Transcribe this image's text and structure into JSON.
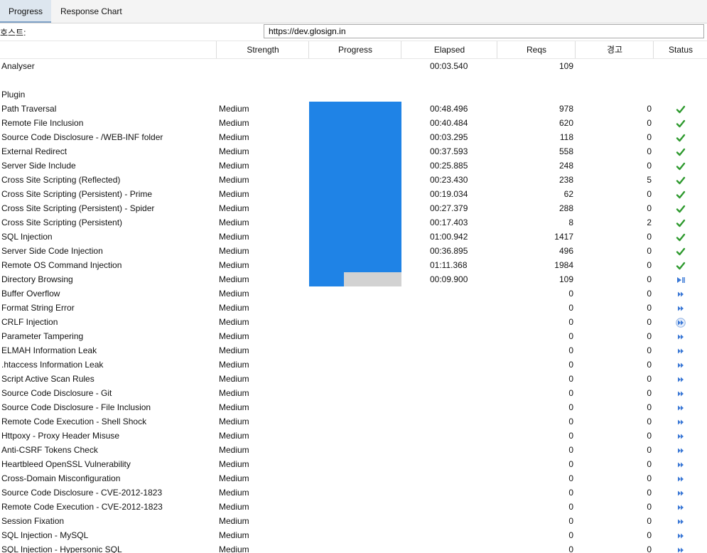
{
  "tabs": [
    {
      "label": "Progress",
      "active": true
    },
    {
      "label": "Response Chart",
      "active": false
    }
  ],
  "host": {
    "label": "호스트:",
    "value": "https://dev.glosign.in"
  },
  "columns": [
    "",
    "Strength",
    "Progress",
    "Elapsed",
    "Reqs",
    "경고",
    "Status"
  ],
  "analyser": {
    "name": "Analyser",
    "elapsed": "00:03.540",
    "reqs": "109"
  },
  "plugin_header": "Plugin",
  "plugins": [
    {
      "name": "Path Traversal",
      "strength": "Medium",
      "progress": 100,
      "elapsed": "00:48.496",
      "reqs": "978",
      "alerts": "0",
      "status": "done"
    },
    {
      "name": "Remote File Inclusion",
      "strength": "Medium",
      "progress": 100,
      "elapsed": "00:40.484",
      "reqs": "620",
      "alerts": "0",
      "status": "done"
    },
    {
      "name": "Source Code Disclosure - /WEB-INF folder",
      "strength": "Medium",
      "progress": 100,
      "elapsed": "00:03.295",
      "reqs": "118",
      "alerts": "0",
      "status": "done"
    },
    {
      "name": "External Redirect",
      "strength": "Medium",
      "progress": 100,
      "elapsed": "00:37.593",
      "reqs": "558",
      "alerts": "0",
      "status": "done"
    },
    {
      "name": "Server Side Include",
      "strength": "Medium",
      "progress": 100,
      "elapsed": "00:25.885",
      "reqs": "248",
      "alerts": "0",
      "status": "done"
    },
    {
      "name": "Cross Site Scripting (Reflected)",
      "strength": "Medium",
      "progress": 100,
      "elapsed": "00:23.430",
      "reqs": "238",
      "alerts": "5",
      "status": "done"
    },
    {
      "name": "Cross Site Scripting (Persistent) - Prime",
      "strength": "Medium",
      "progress": 100,
      "elapsed": "00:19.034",
      "reqs": "62",
      "alerts": "0",
      "status": "done"
    },
    {
      "name": "Cross Site Scripting (Persistent) - Spider",
      "strength": "Medium",
      "progress": 100,
      "elapsed": "00:27.379",
      "reqs": "288",
      "alerts": "0",
      "status": "done"
    },
    {
      "name": "Cross Site Scripting (Persistent)",
      "strength": "Medium",
      "progress": 100,
      "elapsed": "00:17.403",
      "reqs": "8",
      "alerts": "2",
      "status": "done"
    },
    {
      "name": "SQL Injection",
      "strength": "Medium",
      "progress": 100,
      "elapsed": "01:00.942",
      "reqs": "1417",
      "alerts": "0",
      "status": "done"
    },
    {
      "name": "Server Side Code Injection",
      "strength": "Medium",
      "progress": 100,
      "elapsed": "00:36.895",
      "reqs": "496",
      "alerts": "0",
      "status": "done"
    },
    {
      "name": "Remote OS Command Injection",
      "strength": "Medium",
      "progress": 100,
      "elapsed": "01:11.368",
      "reqs": "1984",
      "alerts": "0",
      "status": "done"
    },
    {
      "name": "Directory Browsing",
      "strength": "Medium",
      "progress": 38,
      "elapsed": "00:09.900",
      "reqs": "109",
      "alerts": "0",
      "status": "running"
    },
    {
      "name": "Buffer Overflow",
      "strength": "Medium",
      "progress": null,
      "elapsed": "",
      "reqs": "0",
      "alerts": "0",
      "status": "pending"
    },
    {
      "name": "Format String Error",
      "strength": "Medium",
      "progress": null,
      "elapsed": "",
      "reqs": "0",
      "alerts": "0",
      "status": "pending"
    },
    {
      "name": "CRLF Injection",
      "strength": "Medium",
      "progress": null,
      "elapsed": "",
      "reqs": "0",
      "alerts": "0",
      "status": "pending-hover"
    },
    {
      "name": "Parameter Tampering",
      "strength": "Medium",
      "progress": null,
      "elapsed": "",
      "reqs": "0",
      "alerts": "0",
      "status": "pending"
    },
    {
      "name": "ELMAH Information Leak",
      "strength": "Medium",
      "progress": null,
      "elapsed": "",
      "reqs": "0",
      "alerts": "0",
      "status": "pending"
    },
    {
      "name": ".htaccess Information Leak",
      "strength": "Medium",
      "progress": null,
      "elapsed": "",
      "reqs": "0",
      "alerts": "0",
      "status": "pending"
    },
    {
      "name": "Script Active Scan Rules",
      "strength": "Medium",
      "progress": null,
      "elapsed": "",
      "reqs": "0",
      "alerts": "0",
      "status": "pending"
    },
    {
      "name": "Source Code Disclosure - Git",
      "strength": "Medium",
      "progress": null,
      "elapsed": "",
      "reqs": "0",
      "alerts": "0",
      "status": "pending"
    },
    {
      "name": "Source Code Disclosure - File Inclusion",
      "strength": "Medium",
      "progress": null,
      "elapsed": "",
      "reqs": "0",
      "alerts": "0",
      "status": "pending"
    },
    {
      "name": "Remote Code Execution - Shell Shock",
      "strength": "Medium",
      "progress": null,
      "elapsed": "",
      "reqs": "0",
      "alerts": "0",
      "status": "pending"
    },
    {
      "name": "Httpoxy - Proxy Header Misuse",
      "strength": "Medium",
      "progress": null,
      "elapsed": "",
      "reqs": "0",
      "alerts": "0",
      "status": "pending"
    },
    {
      "name": "Anti-CSRF Tokens Check",
      "strength": "Medium",
      "progress": null,
      "elapsed": "",
      "reqs": "0",
      "alerts": "0",
      "status": "pending"
    },
    {
      "name": "Heartbleed OpenSSL Vulnerability",
      "strength": "Medium",
      "progress": null,
      "elapsed": "",
      "reqs": "0",
      "alerts": "0",
      "status": "pending"
    },
    {
      "name": "Cross-Domain Misconfiguration",
      "strength": "Medium",
      "progress": null,
      "elapsed": "",
      "reqs": "0",
      "alerts": "0",
      "status": "pending"
    },
    {
      "name": "Source Code Disclosure - CVE-2012-1823",
      "strength": "Medium",
      "progress": null,
      "elapsed": "",
      "reqs": "0",
      "alerts": "0",
      "status": "pending"
    },
    {
      "name": "Remote Code Execution - CVE-2012-1823",
      "strength": "Medium",
      "progress": null,
      "elapsed": "",
      "reqs": "0",
      "alerts": "0",
      "status": "pending"
    },
    {
      "name": "Session Fixation",
      "strength": "Medium",
      "progress": null,
      "elapsed": "",
      "reqs": "0",
      "alerts": "0",
      "status": "pending"
    },
    {
      "name": "SQL Injection - MySQL",
      "strength": "Medium",
      "progress": null,
      "elapsed": "",
      "reqs": "0",
      "alerts": "0",
      "status": "pending"
    },
    {
      "name": "SQL Injection - Hypersonic SQL",
      "strength": "Medium",
      "progress": null,
      "elapsed": "",
      "reqs": "0",
      "alerts": "0",
      "status": "pending"
    }
  ],
  "colors": {
    "progress_fill": "#1f83e6",
    "progress_track": "#d2d2d2",
    "done_check": "#2f9a2f",
    "pending_arrow": "#3a78d6"
  }
}
